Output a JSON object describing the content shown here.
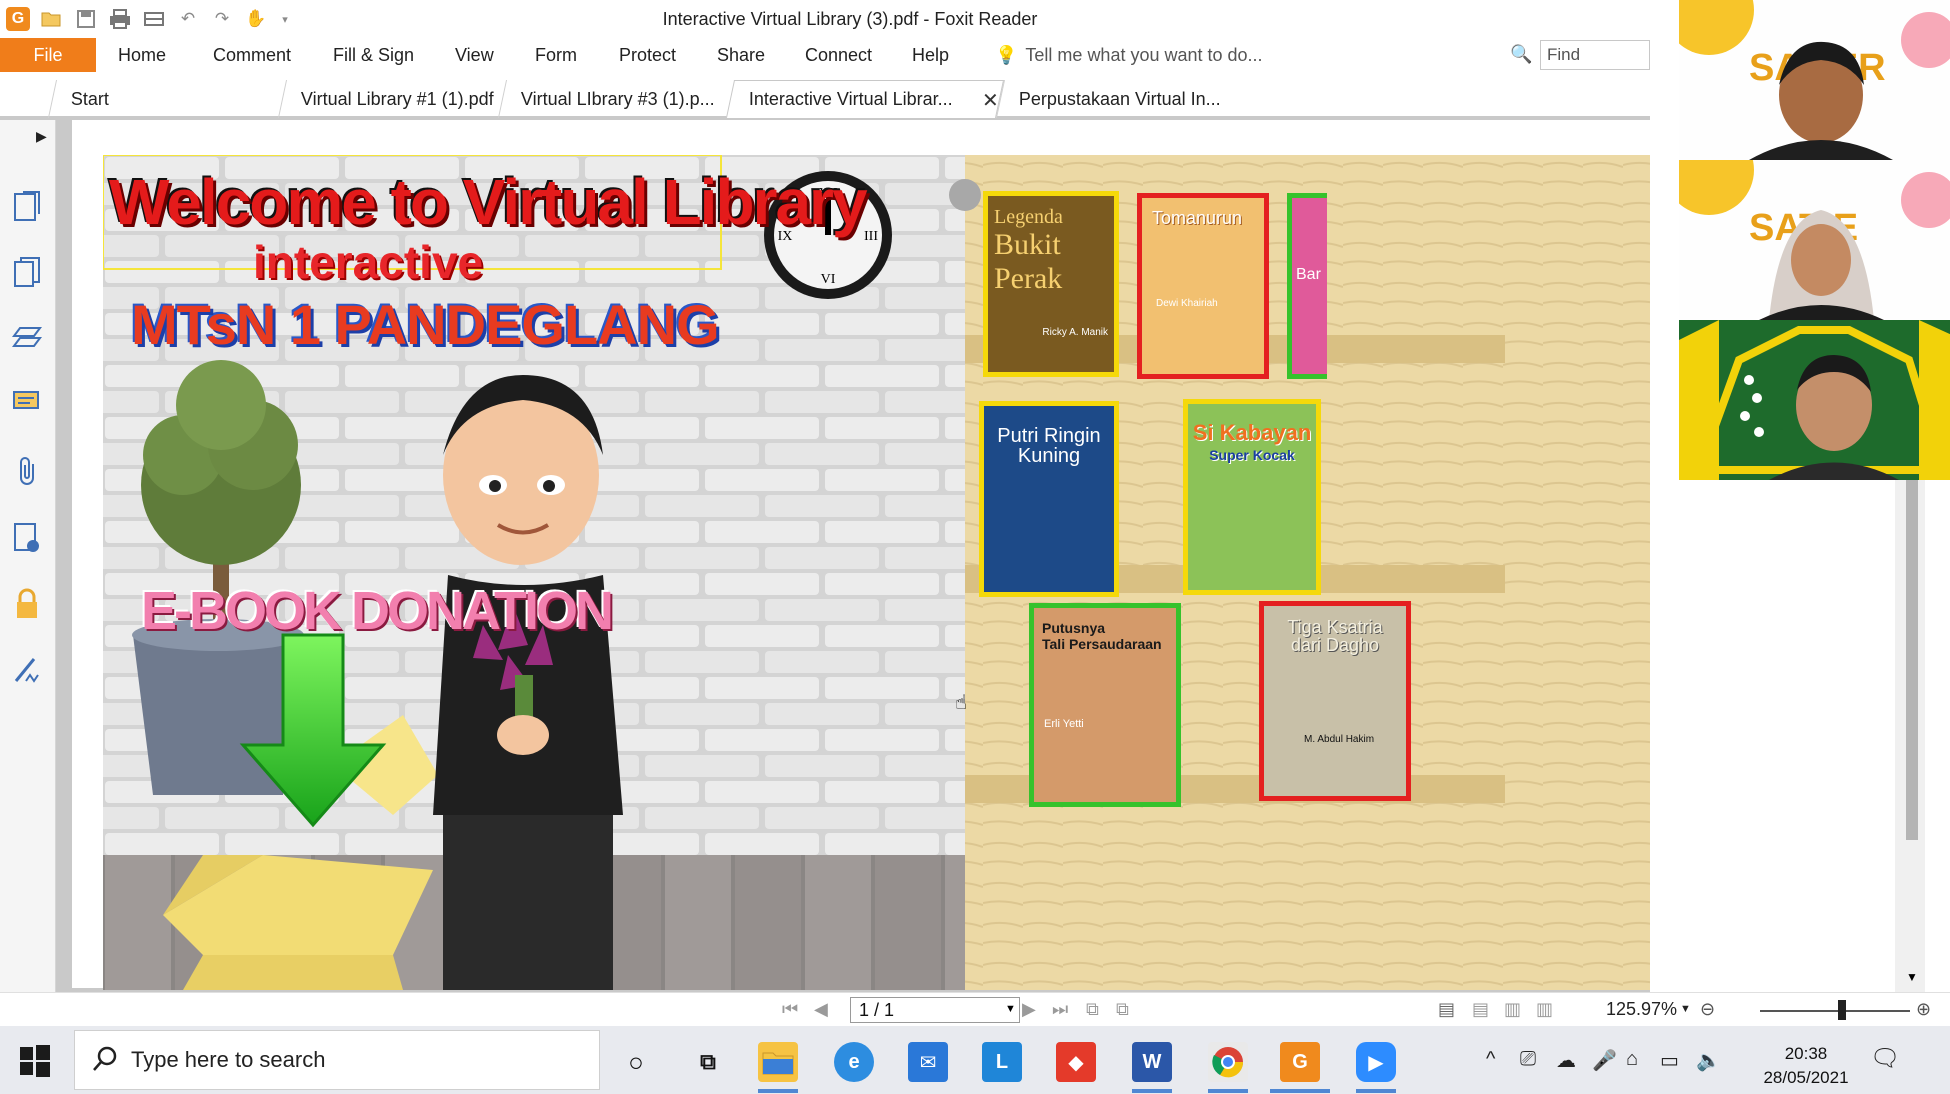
{
  "window": {
    "title": "Interactive Virtual Library (3).pdf - Foxit Reader"
  },
  "ribbon": {
    "file": "File",
    "tabs": [
      "Home",
      "Comment",
      "Fill & Sign",
      "View",
      "Form",
      "Protect",
      "Share",
      "Connect",
      "Help"
    ],
    "tell_me": "Tell me what you want to do...",
    "find_placeholder": "Find"
  },
  "doc_tabs": [
    {
      "label": "Start"
    },
    {
      "label": "Virtual Library #1 (1).pdf"
    },
    {
      "label": "Virtual LIbrary #3 (1).p..."
    },
    {
      "label": "Interactive Virtual Librar...",
      "active": true
    },
    {
      "label": "Perpustakaan Virtual In..."
    }
  ],
  "slide": {
    "heading": "Welcome to Virtual Library",
    "subheading": "interactive",
    "school": "MTsN 1 PANDEGLANG",
    "donation": "E-BOOK DONATION",
    "books": [
      {
        "title_line1": "Legenda",
        "title_line2": "Bukit Perak",
        "author": "Ricky A. Manik",
        "frame": "#f5d90a",
        "color": "#7a5a20"
      },
      {
        "title_line1": "Tomanurun",
        "title_line2": "",
        "author": "Dewi Khairiah",
        "frame": "#e42020",
        "color": "#e8a030"
      },
      {
        "title_line1": "Bar",
        "title_line2": "",
        "author": "",
        "frame": "#36c22c",
        "color": "#e05a9a"
      },
      {
        "title_line1": "Putri Ringin",
        "title_line2": "Kuning",
        "author": "",
        "frame": "#f5d90a",
        "color": "#1d4a88"
      },
      {
        "title_line1": "Si Kabayan",
        "title_line2": "Super Kocak",
        "author": "",
        "frame": "#f5d90a",
        "color": "#7fb84a"
      },
      {
        "title_line1": "Putusnya",
        "title_line2": "Tali Persaudaraan",
        "author": "Erli Yetti",
        "frame": "#36c22c",
        "color": "#c88a5a"
      },
      {
        "title_line1": "Tiga Ksatria",
        "title_line2": "dari Dagho",
        "author": "M. Abdul Hakim",
        "frame": "#e42020",
        "color": "#c8c0a8"
      }
    ]
  },
  "statusbar": {
    "page": "1 / 1",
    "zoom": "125.97%"
  },
  "taskbar": {
    "search_placeholder": "Type here to search",
    "time": "20:38",
    "date": "28/05/2021"
  },
  "colors": {
    "accent": "#f07d1a",
    "title_red": "#e41b1b",
    "school_blue": "#2a58c8"
  }
}
